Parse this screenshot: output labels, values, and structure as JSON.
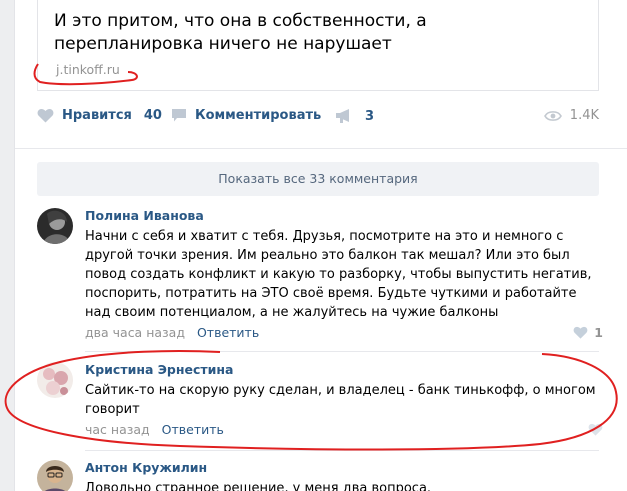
{
  "post": {
    "link_title": "И это притом, что она в собственности, а перепланировка ничего не нарушает",
    "link_domain": "j.tinkoff.ru"
  },
  "actions": {
    "like_label": "Нравится",
    "like_count": "40",
    "comment_label": "Комментировать",
    "share_count": "3",
    "views": "1.4K"
  },
  "show_all_label": "Показать все 33 комментария",
  "comments": [
    {
      "author": "Полина Иванова",
      "text": "Начни с себя и хватит с тебя. Друзья, посмотрите на это и немного с другой точки зрения. Им реально это балкон так мешал? Или это был повод создать конфликт и какую то разборку, чтобы выпустить негатив, поспорить, потратить на ЭТО своё время. Будьте чуткими и работайте над своим потенциалом, а не жалуйтесь на чужие балконы",
      "time": "два часа назад",
      "reply": "Ответить",
      "likes": "1"
    },
    {
      "author": "Кристина Эрнестина",
      "text": "Сайтик-то на скорую руку сделан, и владелец - банк тинькофф, о многом говорит",
      "time": "час назад",
      "reply": "Ответить",
      "likes": ""
    },
    {
      "author": "Антон Кружилин",
      "text": "Довольно странное решение, у меня два вопроса.",
      "time": "",
      "reply": "",
      "likes": ""
    }
  ],
  "colors": {
    "link": "#2a5885",
    "muted": "#939393",
    "annotation": "#e02020"
  }
}
